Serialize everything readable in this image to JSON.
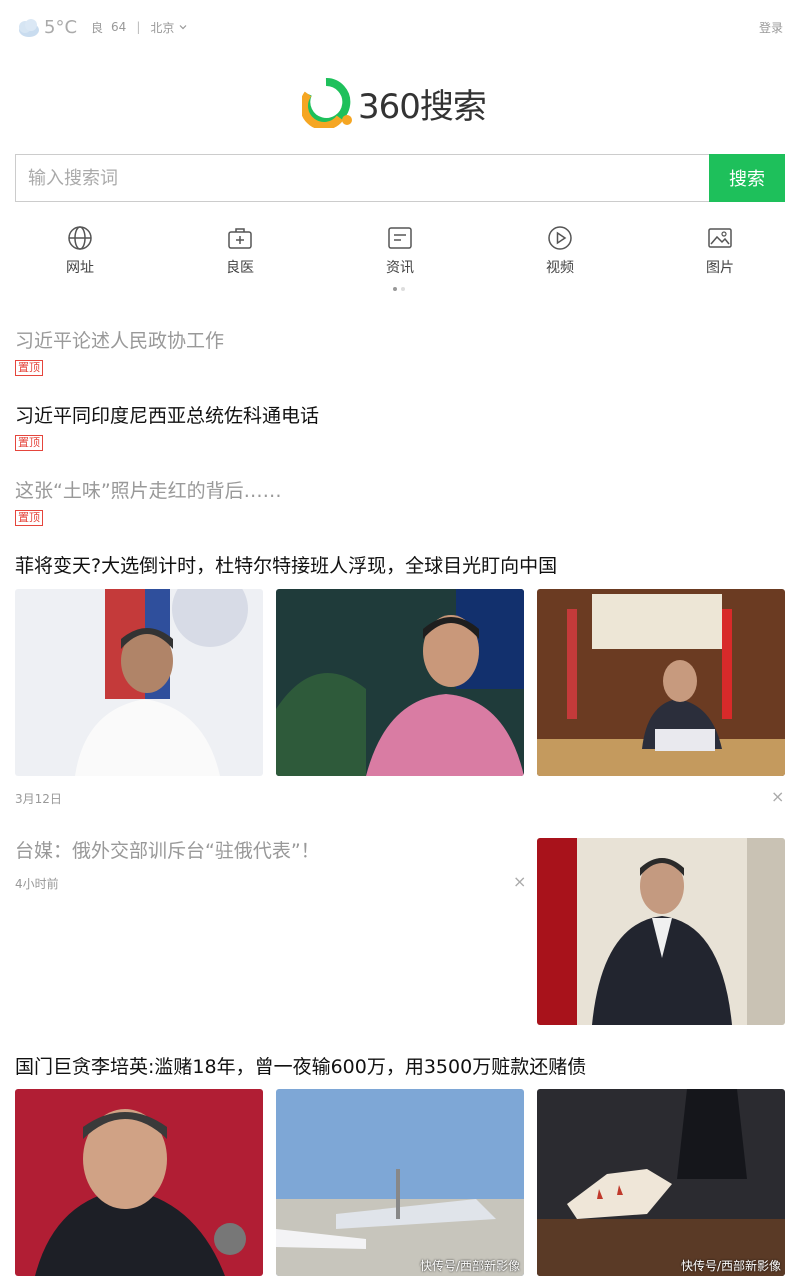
{
  "topbar": {
    "temperature": "5°C",
    "air_quality_label": "良",
    "air_quality_value": "64",
    "separator": "|",
    "city": "北京",
    "login": "登录"
  },
  "logo": {
    "text": "360搜索"
  },
  "search": {
    "placeholder": "输入搜索词",
    "value": "",
    "button": "搜索"
  },
  "nav": [
    {
      "label": "网址",
      "icon": "globe-icon"
    },
    {
      "label": "良医",
      "icon": "medical-kit-icon"
    },
    {
      "label": "资讯",
      "icon": "news-icon"
    },
    {
      "label": "视频",
      "icon": "play-icon"
    },
    {
      "label": "图片",
      "icon": "image-icon"
    }
  ],
  "pager": {
    "pages": 2,
    "active": 1
  },
  "headlines": [
    {
      "title": "习近平论述人民政协工作",
      "tag": "置顶",
      "read": true
    },
    {
      "title": "习近平同印度尼西亚总统佐科通电话",
      "tag": "置顶",
      "read": false
    },
    {
      "title": "这张“土味”照片走红的背后……",
      "tag": "置顶",
      "read": true
    }
  ],
  "news": [
    {
      "title": "菲将变天?大选倒计时，杜特尔特接班人浮现，全球目光盯向中国",
      "time": "3月12日",
      "close": "×",
      "read": false
    },
    {
      "title": "台媒：俄外交部训斥台“驻俄代表”！",
      "time": "4小时前",
      "close": "×",
      "read": true
    },
    {
      "title": "国门巨贪李培英:滥赌18年，曾一夜输600万，用3500万赃款还赌债",
      "watermark": "快传号/西部新影像",
      "read": false
    }
  ],
  "colors": {
    "accent_green": "#1ec05b",
    "logo_green": "#1ec05b",
    "logo_orange": "#f5a623",
    "pin_red": "#e5453c"
  }
}
